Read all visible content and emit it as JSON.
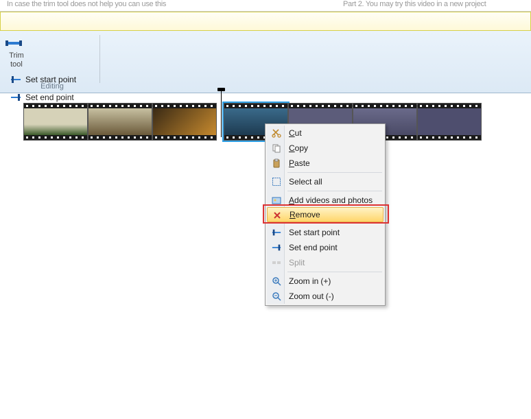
{
  "top_strip": {
    "left_text": "In case the trim tool does not help you can use this",
    "right_text": "Part 2. You may try this video in a new project"
  },
  "ribbon": {
    "trim_tool_label_line1": "Trim",
    "trim_tool_label_line2": "tool",
    "set_start_label": "Set start point",
    "set_end_label": "Set end point",
    "group_caption": "Editing"
  },
  "context_menu": {
    "cut": "Cut",
    "copy": "Copy",
    "paste": "Paste",
    "select_all": "Select all",
    "add_media": "Add videos and photos",
    "remove": "Remove",
    "set_start": "Set start point",
    "set_end": "Set end point",
    "split": "Split",
    "zoom_in": "Zoom in",
    "zoom_in_hint": "(+)",
    "zoom_out": "Zoom out",
    "zoom_out_hint": "(-)"
  }
}
